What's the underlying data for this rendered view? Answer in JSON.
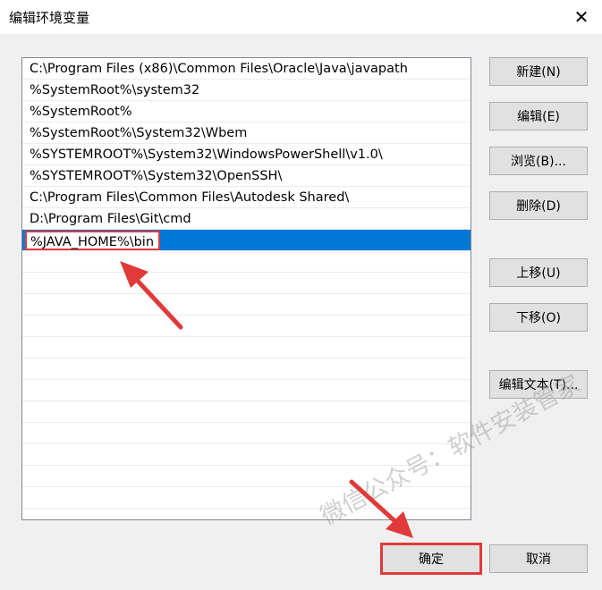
{
  "window": {
    "title": "编辑环境变量",
    "close_glyph": "✕"
  },
  "path_list": {
    "items": [
      "C:\\Program Files (x86)\\Common Files\\Oracle\\Java\\javapath",
      "%SystemRoot%\\system32",
      "%SystemRoot%",
      "%SystemRoot%\\System32\\Wbem",
      "%SYSTEMROOT%\\System32\\WindowsPowerShell\\v1.0\\",
      "%SYSTEMROOT%\\System32\\OpenSSH\\",
      "C:\\Program Files\\Common Files\\Autodesk Shared\\",
      "D:\\Program Files\\Git\\cmd"
    ],
    "editing_value": "%JAVA_HOME%\\bin"
  },
  "buttons": {
    "new": "新建(N)",
    "edit": "编辑(E)",
    "browse": "浏览(B)...",
    "delete": "删除(D)",
    "move_up": "上移(U)",
    "move_down": "下移(O)",
    "edit_text": "编辑文本(T)...",
    "ok": "确定",
    "cancel": "取消"
  },
  "watermark": "微信公众号：软件安装管家",
  "colors": {
    "selection": "#0078d7",
    "annotation_red": "#e03a3a"
  }
}
